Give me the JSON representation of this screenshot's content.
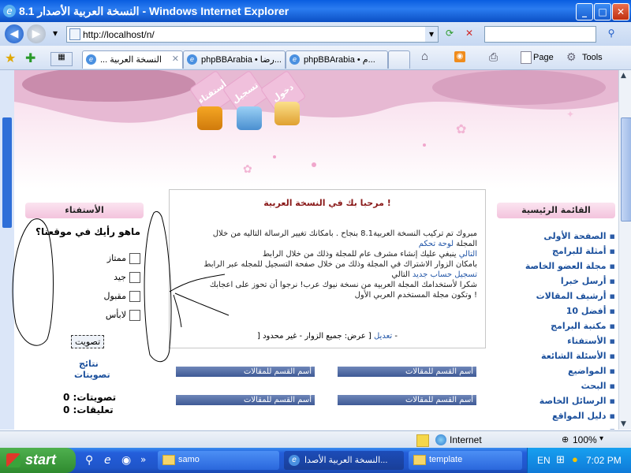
{
  "window": {
    "title": "8.1 النسخة العربية الأصدار - Windows Internet Explorer",
    "minimize": "_",
    "maximize": "□",
    "close": "✕"
  },
  "address": {
    "url": "http://localhost/n/",
    "back_icon": "back-arrow-icon",
    "forward_icon": "forward-arrow-icon",
    "refresh_label": "⟳",
    "stop_label": "✕",
    "search_placeholder": "",
    "search_button": "⚲"
  },
  "tabs": [
    {
      "label": "... النسخة العربية"
    },
    {
      "label": "phpBBArabia • رضا..."
    },
    {
      "label": "phpBBArabia • م..."
    }
  ],
  "toolbar": {
    "page_label": "Page",
    "tools_label": "Tools"
  },
  "banner": {
    "tab1": "أستفتاء",
    "tab2": "تسجيل",
    "tab3": "دخول"
  },
  "right_menu": {
    "header": "القائمة الرئيسية",
    "items": [
      "الصفحة الأولى",
      "أمثلة للبرامج",
      "مجلة العضو الخاصة",
      "أرسل خبرا",
      "أرشيف المقالات",
      "أفضل 10",
      "مكتبة البرامج",
      "الأستفتاء",
      "الأسئلة الشائعة",
      "المواضيع",
      "البحث",
      "الرسائل الخاصة",
      "دليل المواقع",
      "..."
    ]
  },
  "poll": {
    "header": "الأستفتاء",
    "question": "ماهو رأيك في موقعنا؟",
    "options": [
      "ممتاز",
      "جيد",
      "مقبول",
      "لابأس"
    ],
    "vote_button": "تصويت",
    "results_link_1": "نتائج",
    "results_link_2": "تصويتات",
    "votes_label": "تصويتات: 0",
    "comments_label": "تعليقات: 0"
  },
  "welcome": {
    "title": "مرحبا بك في النسخة العربية !",
    "line1": "مبروك تم تركيب النسخة العربية8.1 بنجاح . بامكانك تغيير الرسالة التاليه من خلال",
    "line2_link": "لوحة تحكم",
    "line2_rest": "المجلة",
    "line3": "ينبغي عليك إنشاء مشرف عام للمجلة وذلك من خلال الرابط",
    "line3_link": "التالي",
    "line4": "بامكان الزوار الاشتراك في المجلة وذلك من خلال صفحة التسجيل للمجله عبر الرابط",
    "line5": "التالي",
    "line5_link": "تسجيل حساب جديد",
    "line6": "شكرا لأستخدامك المجلة العربية من نسخة نيوك عرب! نرجوا أن تحوز على اعجابك",
    "line7": "وتكون مجلة المستخدم العربي الأول !",
    "footer_prefix": "[ عرض: جميع الزوار - غير محدود -",
    "footer_link": "تعديل",
    "footer_suffix": "]"
  },
  "categories": [
    "أسم القسم للمقالات",
    "أسم القسم للمقالات",
    "أسم القسم للمقالات",
    "أسم القسم للمقالات"
  ],
  "status": {
    "zone": "Internet",
    "zoom": "100%"
  },
  "taskbar": {
    "start": "start",
    "buttons": [
      "samo",
      "النسخة العربية الأصدا...",
      "template"
    ],
    "lang": "EN",
    "clock": "7:02 PM"
  },
  "colors": {
    "titlebar": "#0a5ee0",
    "menu_link": "#1a4f9c",
    "banner_pink": "#f5d8ea",
    "category_bar": "#3f5a96"
  }
}
